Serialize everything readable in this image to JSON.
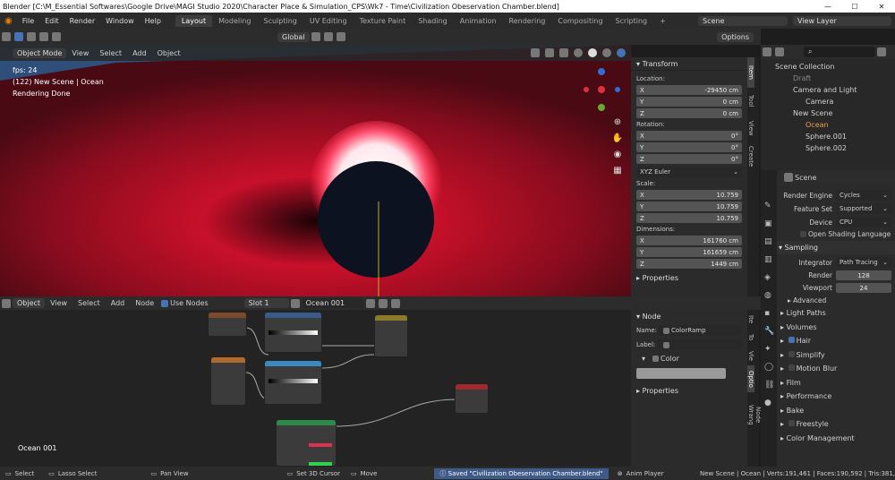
{
  "window": {
    "title": "Blender [C:\\M_Essential Softwares\\Google Drive\\MAGI Studio 2020\\Character Place & Simulation_CPS\\Wk7 - Time\\Civilization Obeservation Chamber.blend]"
  },
  "menu": [
    "File",
    "Edit",
    "Render",
    "Window",
    "Help"
  ],
  "workspaces": [
    "Layout",
    "Modeling",
    "Sculpting",
    "UV Editing",
    "Texture Paint",
    "Shading",
    "Animation",
    "Rendering",
    "Compositing",
    "Scripting"
  ],
  "scene": "Scene",
  "view_layer": "View Layer",
  "toolbar": {
    "orientation": "Global",
    "options": "Options"
  },
  "viewport": {
    "mode": "Object Mode",
    "menus": [
      "View",
      "Select",
      "Add",
      "Object"
    ],
    "fps": "fps: 24",
    "scene_info": "(122) New Scene | Ocean",
    "render_status": "Rendering Done"
  },
  "transform": {
    "title": "Transform",
    "location_label": "Location:",
    "location": [
      "-29450 cm",
      "0 cm",
      "0 cm"
    ],
    "rotation_label": "Rotation:",
    "rotation": [
      "0°",
      "0°",
      "0°"
    ],
    "euler": "XYZ Euler",
    "scale_label": "Scale:",
    "scale": [
      "10.759",
      "10.759",
      "10.759"
    ],
    "dimensions_label": "Dimensions:",
    "dimensions": [
      "161760 cm",
      "161659 cm",
      "1449 cm"
    ],
    "axes": [
      "X",
      "Y",
      "Z"
    ],
    "properties": "Properties"
  },
  "npanel_tabs": [
    "Item",
    "Tool",
    "View",
    "Create"
  ],
  "node_editor": {
    "editor_type": "Object",
    "menus": [
      "View",
      "Select",
      "Add",
      "Node"
    ],
    "use_nodes": "Use Nodes",
    "slot": "Slot 1",
    "material": "Ocean 001",
    "label": "Ocean 001"
  },
  "node_panel": {
    "title": "Node",
    "name_label": "Name:",
    "name": "ColorRamp",
    "label_label": "Label:",
    "color": "Color",
    "properties": "Properties",
    "tabs": [
      "Ite",
      "To",
      "Vie",
      "Optio",
      "Node Wrang"
    ]
  },
  "outliner": {
    "items": [
      {
        "name": "Scene Collection",
        "lvl": 0
      },
      {
        "name": "Draft",
        "lvl": 1
      },
      {
        "name": "Camera and Light",
        "lvl": 1
      },
      {
        "name": "Camera",
        "lvl": 2
      },
      {
        "name": "New Scene",
        "lvl": 1
      },
      {
        "name": "Ocean",
        "lvl": 2
      },
      {
        "name": "Sphere.001",
        "lvl": 2
      },
      {
        "name": "Sphere.002",
        "lvl": 2
      }
    ]
  },
  "properties": {
    "scene": "Scene",
    "render_engine_label": "Render Engine",
    "render_engine": "Cycles",
    "feature_set_label": "Feature Set",
    "feature_set": "Supported",
    "device_label": "Device",
    "device": "CPU",
    "osl": "Open Shading Language",
    "sampling": "Sampling",
    "integrator_label": "Integrator",
    "integrator": "Path Tracing",
    "render_label": "Render",
    "render": "128",
    "viewport_label": "Viewport",
    "viewport": "24",
    "advanced": "Advanced",
    "sections": [
      "Light Paths",
      "Volumes",
      "Hair",
      "Simplify",
      "Motion Blur",
      "Film",
      "Performance",
      "Bake",
      "Freestyle",
      "Color Management"
    ]
  },
  "status": {
    "select": "Select",
    "lasso": "Lasso Select",
    "pan": "Pan View",
    "cursor": "Set 3D Cursor",
    "move": "Move",
    "saved": "Saved \"Civilization Obeservation Chamber.blend\"",
    "anim": "Anim Player",
    "stats": "New Scene | Ocean | Verts:191,461 | Faces:190,592 | Tris:381,18"
  },
  "colors": {
    "accent": "#4772b3",
    "header": "#2b2b2b"
  }
}
